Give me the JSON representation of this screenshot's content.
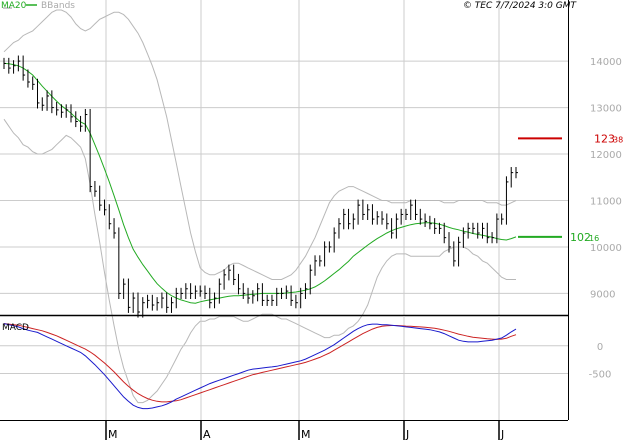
{
  "header": {
    "legend_ma": "MA20",
    "legend_bb": "BBands",
    "copyright": "© TEC 7/7/2024 3:0 GMT"
  },
  "colors": {
    "price": "#000000",
    "ma20": "#22aa22",
    "bbands": "#b8b8b8",
    "grid": "#cccccc",
    "macd": "#1a1acc",
    "signal": "#cc2222",
    "marker_red": "#cc0000",
    "marker_green": "#22aa22"
  },
  "chart_data": [
    {
      "type": "line",
      "panel": "price",
      "x_labels": [
        "M",
        "A",
        "M",
        "J",
        "J"
      ],
      "yticks": [
        "9000",
        "10000",
        "11000",
        "12000",
        "13000",
        "14000"
      ],
      "ylim": [
        8600,
        15100
      ],
      "markers": [
        {
          "name": "resistance",
          "value": 12338,
          "label_main": "123",
          "label_small": "38"
        },
        {
          "name": "support",
          "value": 10216,
          "label_main": "102",
          "label_small": "16"
        }
      ],
      "series": [
        {
          "name": "price",
          "values": [
            13950,
            13850,
            13900,
            14000,
            13700,
            13550,
            13500,
            13100,
            13050,
            13250,
            13000,
            12950,
            12900,
            12950,
            12800,
            12700,
            12600,
            12850,
            11300,
            11200,
            10900,
            10800,
            10500,
            10300,
            9000,
            9200,
            8700,
            8900,
            8600,
            8800,
            8850,
            8750,
            8800,
            8900,
            8700,
            8800,
            9000,
            9000,
            9100,
            9000,
            9050,
            9050,
            9000,
            8800,
            8900,
            9200,
            9400,
            9500,
            9300,
            9100,
            9000,
            8900,
            8950,
            9100,
            8850,
            8850,
            8850,
            9000,
            9000,
            9050,
            8850,
            8800,
            9000,
            9100,
            9500,
            9700,
            9700,
            10000,
            10000,
            10300,
            10500,
            10700,
            10500,
            10600,
            10900,
            10700,
            10800,
            10600,
            10650,
            10600,
            10500,
            10300,
            10600,
            10700,
            10700,
            10900,
            10700,
            10600,
            10550,
            10500,
            10400,
            10400,
            10200,
            10000,
            9700,
            10100,
            10300,
            10400,
            10400,
            10300,
            10400,
            10200,
            10200,
            10600,
            10600,
            11400,
            11600,
            11600
          ]
        },
        {
          "name": "MA20",
          "values": [
            13950,
            13945,
            13925,
            13900,
            13850,
            13780,
            13700,
            13580,
            13460,
            13350,
            13240,
            13140,
            13040,
            12960,
            12880,
            12780,
            12690,
            12640,
            12450,
            12200,
            11950,
            11680,
            11400,
            11100,
            10800,
            10480,
            10200,
            9950,
            9780,
            9620,
            9480,
            9340,
            9210,
            9110,
            9020,
            8950,
            8900,
            8860,
            8830,
            8800,
            8790,
            8820,
            8840,
            8860,
            8880,
            8900,
            8920,
            8940,
            8950,
            8950,
            8960,
            8970,
            8980,
            8990,
            9000,
            9000,
            9000,
            9000,
            9000,
            9010,
            9020,
            9030,
            9050,
            9070,
            9100,
            9140,
            9200,
            9270,
            9350,
            9430,
            9510,
            9600,
            9690,
            9800,
            9880,
            9960,
            10040,
            10110,
            10180,
            10240,
            10300,
            10350,
            10390,
            10420,
            10450,
            10480,
            10500,
            10510,
            10520,
            10520,
            10510,
            10490,
            10460,
            10420,
            10390,
            10370,
            10340,
            10320,
            10290,
            10270,
            10250,
            10230,
            10210,
            10180,
            10160,
            10150,
            10180,
            10216
          ]
        },
        {
          "name": "BBands upper",
          "values": [
            14200,
            14300,
            14400,
            14450,
            14550,
            14600,
            14650,
            14750,
            14850,
            14950,
            15050,
            15100,
            15100,
            15050,
            14950,
            14800,
            14700,
            14650,
            14700,
            14800,
            14900,
            14950,
            15000,
            15050,
            15050,
            15000,
            14900,
            14750,
            14600,
            14400,
            14150,
            13900,
            13600,
            13200,
            12800,
            12300,
            11800,
            11300,
            10800,
            10300,
            9900,
            9550,
            9450,
            9400,
            9400,
            9450,
            9500,
            9600,
            9650,
            9650,
            9600,
            9550,
            9500,
            9450,
            9400,
            9350,
            9300,
            9300,
            9300,
            9350,
            9400,
            9500,
            9650,
            9800,
            10000,
            10200,
            10450,
            10700,
            10950,
            11100,
            11200,
            11250,
            11300,
            11300,
            11250,
            11200,
            11150,
            11100,
            11050,
            11000,
            11000,
            10950,
            10950,
            10950,
            10950,
            11000,
            11000,
            11000,
            11000,
            11000,
            11000,
            11000,
            10950,
            10950,
            10950,
            11000,
            11000,
            11000,
            11000,
            11000,
            11000,
            10950,
            10950,
            10950,
            10900,
            10900,
            10950,
            11000
          ]
        },
        {
          "name": "BBands lower",
          "values": [
            12750,
            12600,
            12450,
            12350,
            12200,
            12150,
            12050,
            12000,
            12000,
            12050,
            12100,
            12200,
            12300,
            12400,
            12350,
            12250,
            12150,
            11900,
            11350,
            10700,
            10100,
            9450,
            8850,
            8300,
            7800,
            7400,
            7100,
            6800,
            6650,
            6650,
            6700,
            6800,
            6900,
            7050,
            7200,
            7400,
            7600,
            7800,
            7950,
            8150,
            8300,
            8400,
            8400,
            8450,
            8450,
            8500,
            8500,
            8500,
            8500,
            8450,
            8400,
            8400,
            8450,
            8500,
            8550,
            8550,
            8550,
            8500,
            8450,
            8450,
            8400,
            8350,
            8300,
            8250,
            8200,
            8150,
            8100,
            8050,
            8050,
            8100,
            8100,
            8150,
            8250,
            8300,
            8400,
            8550,
            8750,
            9050,
            9350,
            9550,
            9700,
            9800,
            9850,
            9850,
            9850,
            9800,
            9800,
            9800,
            9800,
            9800,
            9800,
            9800,
            9900,
            9950,
            10000,
            10000,
            10000,
            9950,
            9850,
            9800,
            9700,
            9650,
            9550,
            9450,
            9350,
            9300,
            9300,
            9300
          ]
        }
      ]
    },
    {
      "type": "line",
      "panel": "macd",
      "title": "MACD",
      "yticks": [
        "0",
        "-500"
      ],
      "ylim": [
        -1300,
        500
      ],
      "x_labels": [
        "M",
        "A",
        "M",
        "J",
        "J"
      ],
      "series": [
        {
          "name": "MACD",
          "values": [
            400,
            380,
            360,
            340,
            310,
            280,
            260,
            240,
            200,
            160,
            120,
            80,
            40,
            0,
            -40,
            -80,
            -120,
            -180,
            -260,
            -340,
            -430,
            -520,
            -620,
            -720,
            -820,
            -920,
            -1000,
            -1070,
            -1110,
            -1130,
            -1130,
            -1120,
            -1100,
            -1080,
            -1050,
            -1010,
            -960,
            -920,
            -880,
            -840,
            -800,
            -760,
            -720,
            -680,
            -650,
            -620,
            -590,
            -560,
            -530,
            -500,
            -470,
            -440,
            -420,
            -410,
            -400,
            -390,
            -380,
            -370,
            -350,
            -330,
            -310,
            -290,
            -270,
            -240,
            -200,
            -160,
            -120,
            -80,
            -30,
            20,
            80,
            140,
            200,
            260,
            310,
            350,
            380,
            390,
            390,
            380,
            380,
            370,
            360,
            350,
            340,
            330,
            320,
            310,
            300,
            290,
            270,
            250,
            220,
            180,
            140,
            100,
            80,
            70,
            70,
            70,
            80,
            90,
            100,
            120,
            140,
            190,
            250,
            300
          ]
        },
        {
          "name": "Signal",
          "values": [
            400,
            390,
            380,
            370,
            350,
            330,
            310,
            290,
            270,
            240,
            210,
            180,
            140,
            100,
            60,
            20,
            -20,
            -60,
            -110,
            -170,
            -240,
            -310,
            -390,
            -470,
            -560,
            -650,
            -730,
            -800,
            -860,
            -910,
            -950,
            -980,
            -1000,
            -1010,
            -1010,
            -1000,
            -990,
            -970,
            -940,
            -910,
            -880,
            -850,
            -820,
            -790,
            -760,
            -730,
            -700,
            -670,
            -640,
            -610,
            -580,
            -550,
            -520,
            -500,
            -480,
            -460,
            -440,
            -420,
            -400,
            -380,
            -360,
            -340,
            -320,
            -300,
            -270,
            -240,
            -210,
            -170,
            -130,
            -80,
            -30,
            20,
            70,
            120,
            170,
            220,
            260,
            300,
            330,
            350,
            360,
            365,
            365,
            360,
            355,
            350,
            345,
            340,
            335,
            325,
            315,
            300,
            280,
            260,
            235,
            210,
            190,
            170,
            155,
            145,
            135,
            125,
            120,
            115,
            120,
            135,
            170,
            200
          ]
        }
      ]
    }
  ]
}
